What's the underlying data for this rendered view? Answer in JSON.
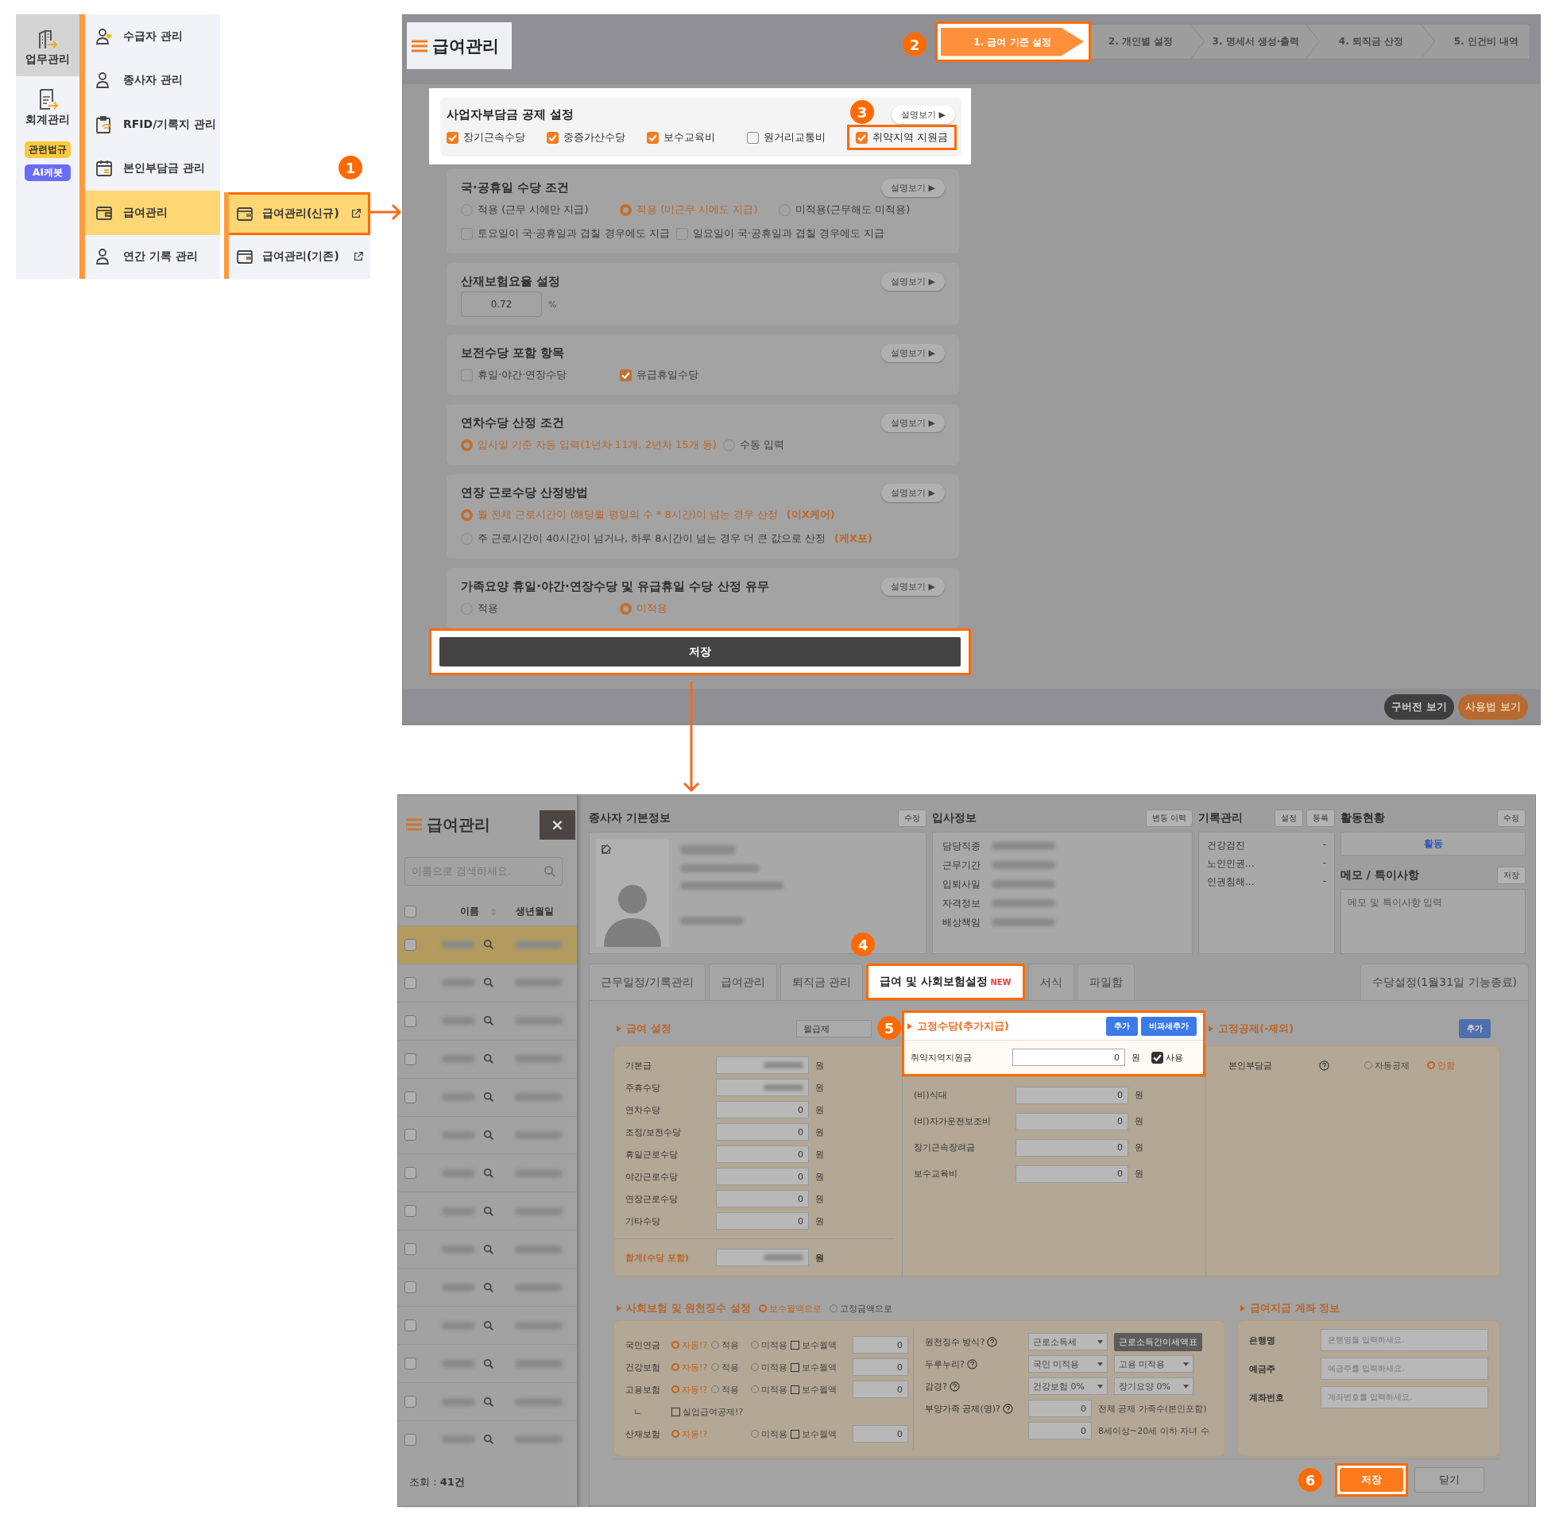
{
  "nav": {
    "categories": [
      {
        "label": "업무관리",
        "kind": "building",
        "selected": true
      },
      {
        "label": "회계관리",
        "kind": "document",
        "selected": false
      }
    ],
    "badges": [
      {
        "label": "관련법규",
        "kind": "law"
      },
      {
        "label": "AI케봇",
        "kind": "ai"
      }
    ],
    "menu": [
      {
        "label": "수급자 관리",
        "kind": "person-heart",
        "selected": false
      },
      {
        "label": "종사자 관리",
        "kind": "person",
        "selected": false
      },
      {
        "label": "RFID/기록지 관리",
        "kind": "clipboard",
        "selected": false
      },
      {
        "label": "본인부담금 관리",
        "kind": "calendar",
        "selected": false
      },
      {
        "label": "급여관리",
        "kind": "wallet",
        "selected": true
      },
      {
        "label": "연간 기록 관리",
        "kind": "person",
        "selected": false
      }
    ],
    "submenu_marker": "1",
    "submenu": [
      {
        "label": "급여관리(신규)",
        "highlighted": true
      },
      {
        "label": "급여관리(기존)",
        "highlighted": false
      }
    ]
  },
  "top": {
    "title": "급여관리",
    "steps_marker": "2",
    "steps": [
      {
        "label": "1. 급여 기준 설정",
        "selected": true
      },
      {
        "label": "2. 개인별 설정",
        "selected": false
      },
      {
        "label": "3. 명세서 생성·출력",
        "selected": false
      },
      {
        "label": "4. 퇴직금 산정",
        "selected": false
      },
      {
        "label": "5. 인건비 내역",
        "selected": false
      }
    ],
    "sections": [
      {
        "title": "사업자부담금 공제 설정",
        "help": "설명보기 ▶",
        "highlighted": true,
        "marker": "3",
        "rows": [
          [
            {
              "kind": "checkbox",
              "label": "장기근속수당",
              "checked": true,
              "highlighted": false
            },
            {
              "kind": "checkbox",
              "label": "중증가산수당",
              "checked": true,
              "highlighted": false
            },
            {
              "kind": "checkbox",
              "label": "보수교육비",
              "checked": true,
              "highlighted": false
            },
            {
              "kind": "checkbox",
              "label": "원거리교통비",
              "checked": false,
              "highlighted": false
            },
            {
              "kind": "checkbox",
              "label": "취약지역 지원금",
              "checked": true,
              "highlighted": true
            }
          ]
        ]
      },
      {
        "title": "국·공휴일 수당 조건",
        "help": "설명보기 ▶",
        "highlighted": false,
        "rows": [
          [
            {
              "kind": "radio",
              "label": "적용 (근무 시에만 지급)",
              "selected": false,
              "highlighted": false
            },
            {
              "kind": "radio",
              "label": "적용 (미근무 시에도 지급)",
              "selected": true,
              "highlighted": false
            },
            {
              "kind": "radio",
              "label": "미적용(근무해도 미적용)",
              "selected": false,
              "highlighted": false
            }
          ],
          [
            {
              "kind": "checkbox",
              "label": "토요일이 국·공휴일과 겹칠 경우에도 지급",
              "checked": false,
              "highlighted": false
            },
            {
              "kind": "checkbox",
              "label": "일요일이 국·공휴일과 겹칠 경우에도 지급",
              "checked": false,
              "highlighted": false
            }
          ]
        ]
      },
      {
        "title": "산재보험요율 설정",
        "help": "설명보기 ▶",
        "highlighted": false,
        "rows": [
          [
            {
              "kind": "input",
              "value": "0.72",
              "unit": "%"
            }
          ]
        ]
      },
      {
        "title": "보전수당 포함 항목",
        "help": "설명보기 ▶",
        "highlighted": false,
        "rows": [
          [
            {
              "kind": "checkbox",
              "label": "휴일·야간·연장수당",
              "checked": false,
              "highlighted": false
            },
            {
              "kind": "checkbox",
              "label": "유급휴일수당",
              "checked": true,
              "highlighted": false
            }
          ]
        ]
      },
      {
        "title": "연차수당 산정 조건",
        "help": "설명보기 ▶",
        "highlighted": false,
        "rows": [
          [
            {
              "kind": "radio",
              "label": "입사일 기준 자동 입력(1년차 11개, 2년차 15개 등)",
              "selected": true,
              "highlighted": false
            },
            {
              "kind": "radio",
              "label": "수동 입력",
              "selected": false,
              "highlighted": false
            }
          ]
        ]
      },
      {
        "title": "연장 근로수당 산정방법",
        "help": "설명보기 ▶",
        "highlighted": false,
        "rows": [
          [
            {
              "kind": "radio",
              "label": "월 전체 근로시간이 (해당월 평일의 수 * 8시간)이 넘는 경우 산정",
              "note": "(이X케어)",
              "selected": true,
              "highlighted": false
            }
          ],
          [
            {
              "kind": "radio",
              "label": "주 근로시간이 40시간이 넘거나, 하루 8시간이 넘는 경우 더 큰 값으로 산정",
              "note": "(케X포)",
              "selected": false,
              "highlighted": false
            }
          ]
        ]
      },
      {
        "title": "가족요양 휴일·야간·연장수당 및 유급휴일 수당 산정 유무",
        "help": "설명보기 ▶",
        "highlighted": false,
        "rows": [
          [
            {
              "kind": "radio",
              "label": "적용",
              "selected": false,
              "highlighted": false
            },
            {
              "kind": "radio",
              "label": "미적용",
              "selected": true,
              "highlighted": false
            }
          ]
        ]
      }
    ],
    "save": "저장",
    "buttons": [
      {
        "label": "구버전 보기",
        "kind": "dark"
      },
      {
        "label": "사용법 보기",
        "kind": "orange"
      }
    ]
  },
  "bottom": {
    "title": "급여관리",
    "close": "×",
    "search_placeholder": "이름으로 검색하세요.",
    "columns": [
      "이름",
      "생년월일"
    ],
    "select_all": {
      "checked": false
    },
    "rows": [
      {
        "selected": true,
        "checked": false
      },
      {
        "selected": false,
        "checked": false
      },
      {
        "selected": false,
        "checked": false
      },
      {
        "selected": false,
        "checked": false
      },
      {
        "selected": false,
        "checked": false
      },
      {
        "selected": false,
        "checked": false
      },
      {
        "selected": false,
        "checked": false
      },
      {
        "selected": false,
        "checked": false
      },
      {
        "selected": false,
        "checked": false
      },
      {
        "selected": false,
        "checked": false
      },
      {
        "selected": false,
        "checked": false
      },
      {
        "selected": false,
        "checked": false
      },
      {
        "selected": false,
        "checked": false
      },
      {
        "selected": false,
        "checked": false
      }
    ],
    "count": "조회 : **41건**",
    "basic": {
      "title": "종사자 기본정보",
      "button": "수정"
    },
    "hire": {
      "title": "입사정보",
      "button": "변동 이력",
      "labels": [
        "담당직종",
        "근무기간",
        "입퇴사일",
        "자격정보",
        "배상책임"
      ]
    },
    "records": {
      "title": "기록관리",
      "buttons": [
        "설정",
        "등록"
      ],
      "items": [
        {
          "label": "건강검진",
          "value": "-"
        },
        {
          "label": "노인인권...",
          "value": "-"
        },
        {
          "label": "인권침해...",
          "value": "-"
        }
      ]
    },
    "activity": {
      "title": "활동현황",
      "button": "수정",
      "status": "활동"
    },
    "memo": {
      "title": "메모 / 특이사항",
      "button": "저장",
      "placeholder": "메모 및 특이사항 입력"
    },
    "tabs_marker": "4",
    "tabs": [
      {
        "label": "근무일정/기록관리",
        "selected": false
      },
      {
        "label": "급여관리",
        "selected": false
      },
      {
        "label": "퇴직금 관리",
        "selected": false
      },
      {
        "label": "급여 및 사회보험설정",
        "badge": "NEW",
        "selected": true
      },
      {
        "label": "서식",
        "selected": false
      },
      {
        "label": "파일함",
        "selected": false
      }
    ],
    "side_tab": "수당설정(1월31일 기능종료)",
    "pay": {
      "title": "급여 설정",
      "select": "월급제",
      "rows": [
        {
          "label": "기본급",
          "unit": "원",
          "kind": "normal"
        },
        {
          "label": "주휴수당",
          "unit": "원",
          "kind": "normal"
        },
        {
          "label": "연차수당",
          "value": "0",
          "unit": "원",
          "kind": "normal"
        },
        {
          "label": "조정/보전수당",
          "value": "0",
          "unit": "원",
          "kind": "normal"
        },
        {
          "label": "휴일근로수당",
          "value": "0",
          "unit": "원",
          "kind": "normal"
        },
        {
          "label": "야간근로수당",
          "value": "0",
          "unit": "원",
          "kind": "normal"
        },
        {
          "label": "연장근로수당",
          "value": "0",
          "unit": "원",
          "kind": "normal"
        },
        {
          "label": "기타수당",
          "value": "0",
          "unit": "원",
          "kind": "normal"
        },
        {
          "label": "합계(수당 포함)",
          "unit": "원",
          "kind": "total"
        }
      ]
    },
    "fixed": {
      "marker": "5",
      "title": "고정수당(추가지급)",
      "buttons": [
        "추가",
        "비과세추가"
      ],
      "first": {
        "label": "취약지역지원금",
        "value": "0",
        "unit": "원",
        "use": "사용",
        "checked": true
      },
      "rows": [
        {
          "label": "(비)식대",
          "value": "0",
          "unit": "원"
        },
        {
          "label": "(비)자가운전보조비",
          "value": "0",
          "unit": "원"
        },
        {
          "label": "장기근속장려금",
          "value": "0",
          "unit": "원"
        },
        {
          "label": "보수교육비",
          "value": "0",
          "unit": "원"
        }
      ]
    },
    "deduct": {
      "title": "고정공제(-제외)",
      "button": "추가",
      "label": "본인부담금",
      "options": [
        {
          "label": "자동공제",
          "selected": false
        },
        {
          "label": "안함",
          "selected": true
        }
      ]
    },
    "insurance": {
      "title": "사회보험 및 원천징수 설정",
      "modes": [
        {
          "label": "보수월액으로",
          "selected": true
        },
        {
          "label": "고정금액으로",
          "selected": false
        }
      ],
      "rows": [
        {
          "kind": "main",
          "label": "국민연금",
          "options": [
            {
              "kind": "radio",
              "label": "자동!?",
              "selected": true
            },
            {
              "kind": "radio",
              "label": "적용",
              "selected": false
            },
            {
              "kind": "radio",
              "label": "미적용",
              "selected": false
            },
            {
              "kind": "checkbox",
              "label": "보수월액",
              "checked": false
            }
          ],
          "value": "0"
        },
        {
          "kind": "main",
          "label": "건강보험",
          "options": [
            {
              "kind": "radio",
              "label": "자동!?",
              "selected": true
            },
            {
              "kind": "radio",
              "label": "적용",
              "selected": false
            },
            {
              "kind": "radio",
              "label": "미적용",
              "selected": false
            },
            {
              "kind": "checkbox",
              "label": "보수월액",
              "checked": false
            }
          ],
          "value": "0"
        },
        {
          "kind": "main",
          "label": "고용보험",
          "options": [
            {
              "kind": "radio",
              "label": "자동!?",
              "selected": true
            },
            {
              "kind": "radio",
              "label": "적용",
              "selected": false
            },
            {
              "kind": "radio",
              "label": "미적용",
              "selected": false
            },
            {
              "kind": "checkbox",
              "label": "보수월액",
              "checked": false
            }
          ],
          "value": "0"
        },
        {
          "kind": "sub",
          "label": "ㄴ",
          "options": [
            {
              "kind": "checkbox",
              "label": "실업급여공제!?",
              "checked": false
            }
          ]
        },
        {
          "kind": "main",
          "label": "산재보험",
          "options": [
            {
              "kind": "radio",
              "label": "자동!?",
              "selected": true
            },
            {
              "kind": "gap"
            },
            {
              "kind": "radio",
              "label": "미적용",
              "selected": false
            },
            {
              "kind": "checkbox",
              "label": "보수월액",
              "checked": false
            }
          ],
          "value": "0"
        }
      ],
      "withholding": [
        {
          "label": "원천징수 방식?",
          "controls": [
            {
              "kind": "select",
              "value": "근로소득세"
            },
            {
              "kind": "button",
              "label": "근로소득간이세액표"
            }
          ]
        },
        {
          "label": "두루누리?",
          "controls": [
            {
              "kind": "select",
              "value": "국민 미적용"
            },
            {
              "kind": "select",
              "value": "고용 미적용"
            }
          ]
        },
        {
          "label": "감경?",
          "controls": [
            {
              "kind": "select",
              "value": "건강보험 0%"
            },
            {
              "kind": "select",
              "value": "장기요양 0%"
            }
          ]
        },
        {
          "label": "부양가족 공제(명)?",
          "controls": [
            {
              "kind": "input",
              "value": "0"
            },
            {
              "kind": "note",
              "label": "전체 공제 가족수(본인포함)"
            }
          ]
        },
        {
          "controls": [
            {
              "kind": "input",
              "value": "0"
            },
            {
              "kind": "note",
              "label": "8세이상~20세 이하 자녀 수"
            }
          ]
        }
      ]
    },
    "account": {
      "title": "급여지급 계좌 정보",
      "fields": [
        {
          "label": "은행명",
          "placeholder": "은행명을 입력하세요."
        },
        {
          "label": "예금주",
          "placeholder": "예금주를 입력하세요."
        },
        {
          "label": "계좌번호",
          "placeholder": "계좌번호를 입력하세요."
        }
      ]
    },
    "save_marker": "6",
    "save": "저장",
    "close_button": "닫기"
  }
}
